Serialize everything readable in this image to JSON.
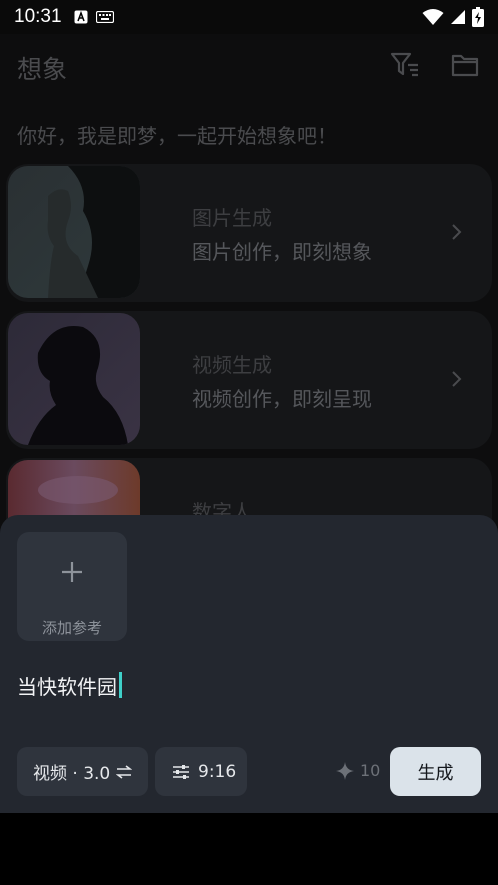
{
  "status_bar": {
    "time": "10:31",
    "left_icons": [
      "a-badge-icon",
      "keyboard-icon"
    ],
    "right_icons": [
      "wifi-icon",
      "signal-icon",
      "battery-icon"
    ]
  },
  "header": {
    "title": "想象",
    "icons": [
      "filter-icon",
      "folder-icon"
    ]
  },
  "greeting": "你好，我是即梦，一起开始想象吧！",
  "cards": [
    {
      "title": "图片生成",
      "subtitle": "图片创作，即刻想象"
    },
    {
      "title": "视频生成",
      "subtitle": "视频创作，即刻呈现"
    },
    {
      "title": "数字人",
      "subtitle": ""
    }
  ],
  "sheet": {
    "add_reference_label": "添加参考",
    "prompt_value": "当快软件园",
    "model_chip": "视频 · 3.0",
    "ratio_chip": "9:16",
    "credits": "10",
    "generate_label": "生成"
  },
  "colors": {
    "sheet_bg": "#23272f",
    "chip_bg": "#2f343d",
    "generate_bg": "#dbe3ea",
    "cursor": "#3fd0c9"
  }
}
